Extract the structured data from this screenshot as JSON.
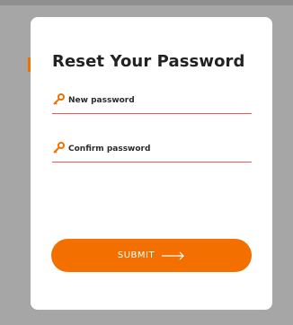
{
  "form": {
    "title": "Reset Your Password",
    "new_password": {
      "label": "New password",
      "icon": "key-icon",
      "value": ""
    },
    "confirm_password": {
      "label": "Confirm password",
      "icon": "key-icon",
      "value": ""
    },
    "submit": {
      "label": "SUBMIT",
      "icon": "arrow-right-icon"
    }
  },
  "colors": {
    "accent": "#f26f00",
    "underline": "#e25c5c",
    "backdrop": "#a6a6a6",
    "card": "#ffffff"
  }
}
